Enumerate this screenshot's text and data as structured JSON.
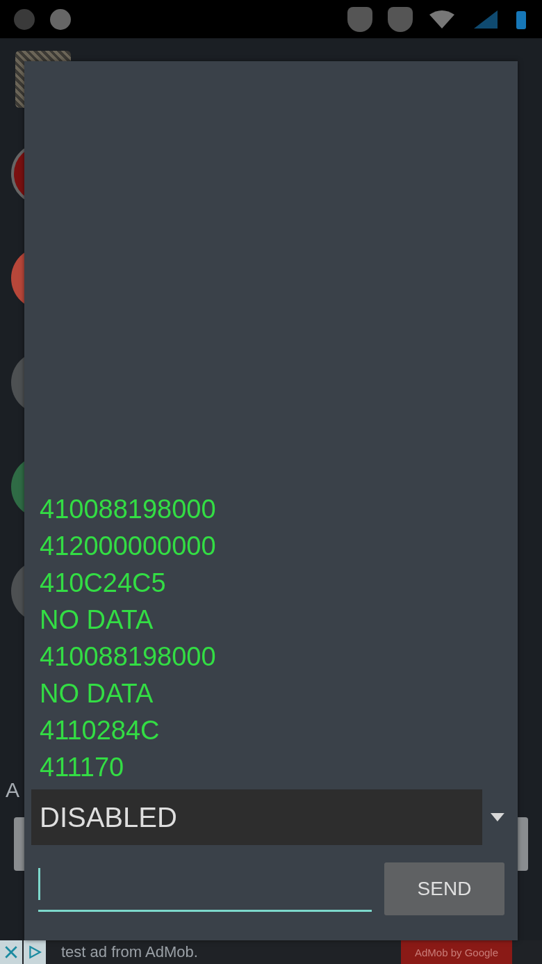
{
  "background": {
    "partial_label": "A"
  },
  "log_lines": [
    "410088198000",
    "412000000000",
    "410C24C5",
    "NO DATA",
    "410088198000",
    "NO DATA",
    "4110284C",
    "411170"
  ],
  "mode_select": {
    "value": "DISABLED"
  },
  "send_button": {
    "label": "SEND"
  },
  "ad_banner": {
    "text": "test ad from AdMob.",
    "button": "AdMob by Google"
  }
}
